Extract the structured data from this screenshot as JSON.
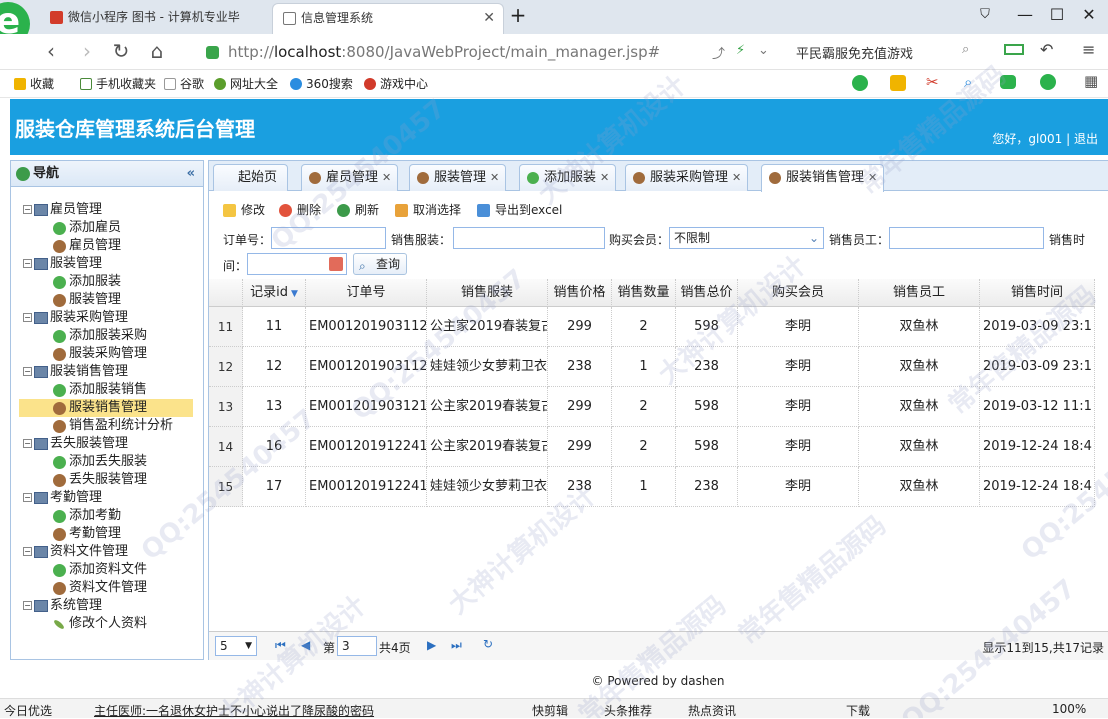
{
  "browser": {
    "tabs": [
      {
        "title": "微信小程序 图书 - 计算机专业毕"
      },
      {
        "title": "信息管理系统"
      }
    ],
    "new_tab": "+",
    "url_prefix": "http://",
    "url_host": "localhost",
    "url_rest": ":8080/JavaWebProject/main_manager.jsp#",
    "search_hint": "平民霸服免充值游戏",
    "bookmarks": [
      "收藏",
      "手机收藏夹",
      "谷歌",
      "网址大全",
      "360搜索",
      "游戏中心"
    ]
  },
  "app": {
    "title": "服装仓库管理系统后台管理",
    "welcome": "您好，gl001",
    "logout": "退出",
    "sep": "|"
  },
  "sidebar": {
    "title": "导航",
    "collapse": "«",
    "groups": [
      {
        "label": "雇员管理",
        "items": [
          "添加雇员",
          "雇员管理"
        ]
      },
      {
        "label": "服装管理",
        "items": [
          "添加服装",
          "服装管理"
        ]
      },
      {
        "label": "服装采购管理",
        "items": [
          "添加服装采购",
          "服装采购管理"
        ]
      },
      {
        "label": "服装销售管理",
        "items": [
          "添加服装销售",
          "服装销售管理",
          "销售盈利统计分析"
        ]
      },
      {
        "label": "丢失服装管理",
        "items": [
          "添加丢失服装",
          "丢失服装管理"
        ]
      },
      {
        "label": "考勤管理",
        "items": [
          "添加考勤",
          "考勤管理"
        ]
      },
      {
        "label": "资料文件管理",
        "items": [
          "添加资料文件",
          "资料文件管理"
        ]
      },
      {
        "label": "系统管理",
        "items": [
          "修改个人资料"
        ]
      }
    ]
  },
  "tabs": [
    "起始页",
    "雇员管理",
    "服装管理",
    "添加服装",
    "服装采购管理",
    "服装销售管理"
  ],
  "toolbar": {
    "edit": "修改",
    "delete": "删除",
    "refresh": "刷新",
    "cancel": "取消选择",
    "export": "导出到excel"
  },
  "filters": {
    "order_label": "订单号：",
    "clothing_label": "销售服装：",
    "member_label": "购买会员：",
    "member_value": "不限制",
    "staff_label": "销售员工：",
    "time_label_1": "销售时",
    "time_label_2": "间：",
    "query": "查询"
  },
  "table": {
    "headers": [
      "记录id",
      "订单号",
      "销售服装",
      "销售价格",
      "销售数量",
      "销售总价",
      "购买会员",
      "销售员工",
      "销售时间"
    ],
    "rows": [
      {
        "rn": "11",
        "id": "11",
        "order": "EM001201903112",
        "item": "公主家2019春装复古",
        "price": "299",
        "qty": "2",
        "total": "598",
        "member": "李明",
        "staff": "双鱼林",
        "time": "2019-03-09 23:1"
      },
      {
        "rn": "12",
        "id": "12",
        "order": "EM001201903112",
        "item": "娃娃领少女萝莉卫衣",
        "price": "238",
        "qty": "1",
        "total": "238",
        "member": "李明",
        "staff": "双鱼林",
        "time": "2019-03-09 23:1"
      },
      {
        "rn": "13",
        "id": "13",
        "order": "EM001201903121",
        "item": "公主家2019春装复古",
        "price": "299",
        "qty": "2",
        "total": "598",
        "member": "李明",
        "staff": "双鱼林",
        "time": "2019-03-12 11:1"
      },
      {
        "rn": "14",
        "id": "16",
        "order": "EM001201912241",
        "item": "公主家2019春装复古",
        "price": "299",
        "qty": "2",
        "total": "598",
        "member": "李明",
        "staff": "双鱼林",
        "time": "2019-12-24 18:4"
      },
      {
        "rn": "15",
        "id": "17",
        "order": "EM001201912241",
        "item": "娃娃领少女萝莉卫衣",
        "price": "238",
        "qty": "1",
        "total": "238",
        "member": "李明",
        "staff": "双鱼林",
        "time": "2019-12-24 18:4"
      }
    ]
  },
  "pager": {
    "page_size": "5",
    "page_pre": "第",
    "page_num": "3",
    "page_post": "共4页",
    "info": "显示11到15,共17记录"
  },
  "footer": "© Powered by dashen",
  "statusbar": {
    "left": "今日优选",
    "news": "主任医师:一名退休女护士不小心说出了降尿酸的密码",
    "quick": "快剪辑",
    "headline": "头条推荐",
    "hot": "热点资讯",
    "download": "下载",
    "zoom": "100%"
  },
  "watermarks": [
    "QQ:254540457",
    "大神计算机设计",
    "常年售精品源码"
  ]
}
